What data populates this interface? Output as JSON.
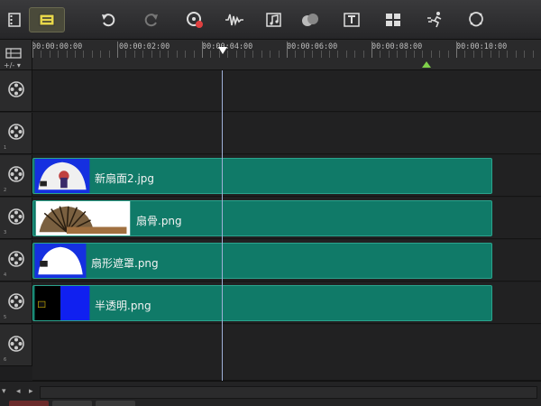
{
  "toolbar": {
    "items": [
      {
        "icon": "storyboard-film-icon"
      },
      {
        "icon": "timeline-view-icon",
        "active": true
      },
      {
        "icon": "undo-icon"
      },
      {
        "icon": "redo-icon"
      },
      {
        "icon": "record-capture-icon"
      },
      {
        "icon": "sound-mixer-icon"
      },
      {
        "icon": "auto-music-icon"
      },
      {
        "icon": "motion-track-icon"
      },
      {
        "icon": "subtitle-editor-icon"
      },
      {
        "icon": "multi-camera-icon"
      },
      {
        "icon": "speed-time-icon"
      },
      {
        "icon": "mask-creator-icon"
      }
    ]
  },
  "ruler": {
    "labels": [
      "00:00:00:00",
      "00:00:02:00",
      "00:00:04:00",
      "00:00:06:00",
      "00:00:08:00",
      "00:00:10:00"
    ]
  },
  "corner": {
    "label": "+/- ▾"
  },
  "tracks": [
    {
      "number": "",
      "clip": null
    },
    {
      "number": "1",
      "clip": null
    },
    {
      "number": "2",
      "clip": {
        "name": "新扇面2.jpg",
        "thumb": "fan-face"
      }
    },
    {
      "number": "3",
      "clip": {
        "name": "扇骨.png",
        "thumb": "fan-ribs"
      }
    },
    {
      "number": "4",
      "clip": {
        "name": "扇形遮罩.png",
        "thumb": "fan-mask"
      }
    },
    {
      "number": "5",
      "clip": {
        "name": "半透明.png",
        "thumb": "half-transparent"
      }
    },
    {
      "number": "6",
      "clip": null
    }
  ],
  "colors": {
    "clip": "#107a68",
    "clip_border": "#2aa48d",
    "playhead": "#9fb0d8",
    "marker": "#7fd04a"
  },
  "bottom": {
    "left_btn": "▾",
    "prev": "◂",
    "next": "▸"
  }
}
